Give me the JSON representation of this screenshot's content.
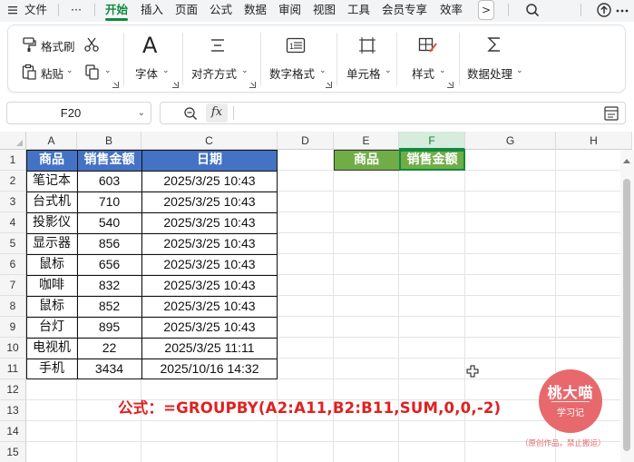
{
  "menu": {
    "file_label": "文件",
    "more_label": "···",
    "tabs": [
      "开始",
      "插入",
      "页面",
      "公式",
      "数据",
      "审阅",
      "视图",
      "工具",
      "会员专享",
      "效率"
    ],
    "active_tab": "开始",
    "overflow_label": ">"
  },
  "ribbon": {
    "format_painter": "格式刷",
    "paste": "粘贴",
    "font": "字体",
    "font_sample": "A",
    "align": "对齐方式",
    "number_format": "数字格式",
    "cell": "单元格",
    "style": "样式",
    "data_process": "数据处理"
  },
  "formula_bar": {
    "name_box": "F20",
    "fx_label": "fx",
    "formula_value": ""
  },
  "columns": [
    "A",
    "B",
    "C",
    "D",
    "E",
    "F",
    "G",
    "H"
  ],
  "selected_column": "F",
  "rows": [
    "1",
    "2",
    "3",
    "4",
    "5",
    "6",
    "7",
    "8",
    "9",
    "10",
    "11",
    "12",
    "13",
    "14",
    "15"
  ],
  "table": {
    "headers": [
      "商品",
      "销售金额",
      "日期"
    ],
    "records": [
      [
        "笔记本",
        "603",
        "2025/3/25 10:43"
      ],
      [
        "台式机",
        "710",
        "2025/3/25 10:43"
      ],
      [
        "投影仪",
        "540",
        "2025/3/25 10:43"
      ],
      [
        "显示器",
        "856",
        "2025/3/25 10:43"
      ],
      [
        "鼠标",
        "656",
        "2025/3/25 10:43"
      ],
      [
        "咖啡",
        "832",
        "2025/3/25 10:43"
      ],
      [
        "鼠标",
        "852",
        "2025/3/25 10:43"
      ],
      [
        "台灯",
        "895",
        "2025/3/25 10:43"
      ],
      [
        "电视机",
        "22",
        "2025/3/25 11:11"
      ],
      [
        "手机",
        "3434",
        "2025/10/16 14:32"
      ]
    ]
  },
  "output_headers": [
    "商品",
    "销售金额"
  ],
  "caption": "公式：=GROUPBY(A2:A11,B2:B11,SUM,0,0,-2)",
  "watermark": {
    "title": "桃大喵",
    "subtitle": "学习记",
    "note": "（原创作品，禁止搬运）"
  },
  "colors": {
    "accent_green": "#128a3e",
    "header_blue": "#4472c4",
    "header_green": "#70ad47",
    "caption_red": "#e02020",
    "watermark_red": "#e8696d"
  }
}
